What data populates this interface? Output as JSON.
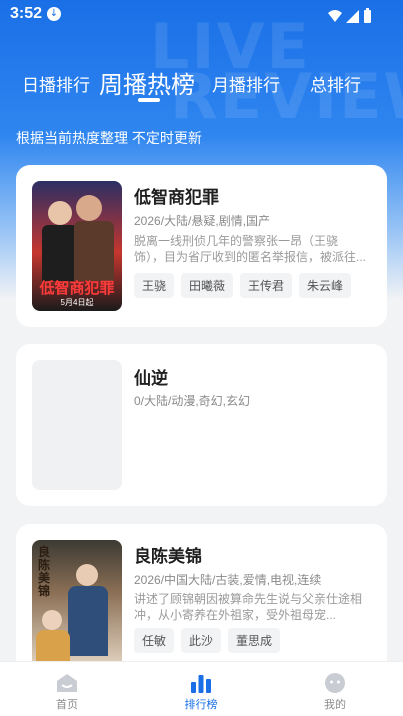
{
  "status_bar": {
    "time": "3:52"
  },
  "tabs": [
    {
      "label": "日播排行",
      "active": false
    },
    {
      "label": "周播热榜",
      "active": true
    },
    {
      "label": "月播排行",
      "active": false
    },
    {
      "label": "总排行",
      "active": false
    }
  ],
  "subtitle": "根据当前热度整理 不定时更新",
  "items": [
    {
      "title": "低智商犯罪",
      "meta": "2026/大陆/悬疑,剧情,国产",
      "desc": "    脱离一线刑侦几年的警察张一昂（王骁 饰），目为省厅收到的匿名举报信，被派往...",
      "tags": [
        "王骁",
        "田曦薇",
        "王传君",
        "朱云峰"
      ],
      "poster_text": "低智商犯罪",
      "poster_date": "5月4日起"
    },
    {
      "title": "仙逆",
      "meta": "0/大陆/动漫,奇幻,玄幻",
      "desc": "",
      "tags": []
    },
    {
      "title": "良陈美锦",
      "meta": "2026/中国大陆/古装,爱情,电视,连续",
      "desc": "讲述了顾锦朝因被算命先生说与父亲仕途相冲，从小寄养在外祖家，受外祖母宠...",
      "tags": [
        "任敏",
        "此沙",
        "董思成"
      ],
      "poster_text": "良陈美锦"
    }
  ],
  "bottom_nav": [
    {
      "label": "首页",
      "icon": "home-icon",
      "active": false
    },
    {
      "label": "排行榜",
      "icon": "chart-bars-icon",
      "active": true
    },
    {
      "label": "我的",
      "icon": "profile-face-icon",
      "active": false
    }
  ],
  "colors": {
    "accent": "#1a6fe6",
    "hero_top": "#1a6fe6",
    "background": "#f2f3f5"
  }
}
